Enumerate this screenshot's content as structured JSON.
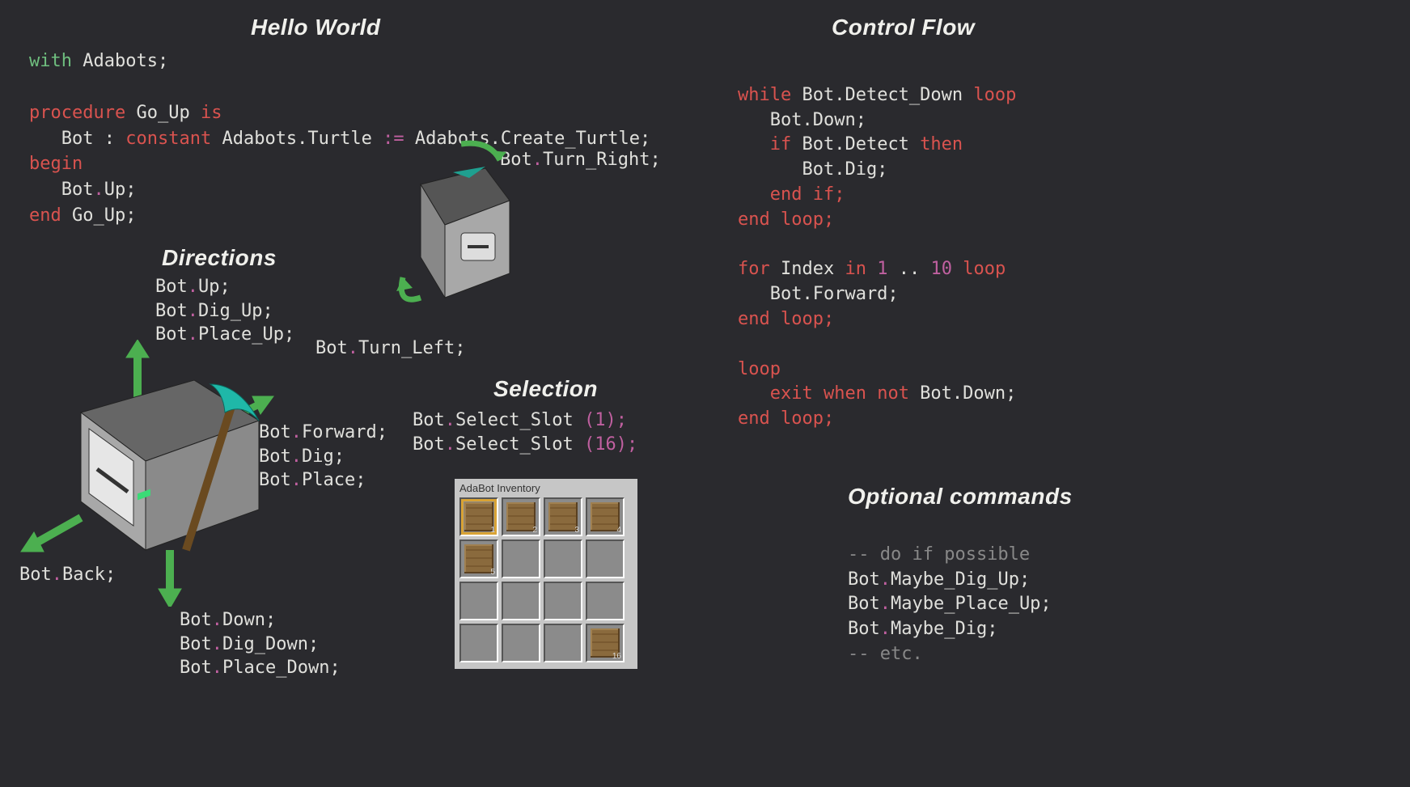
{
  "hello": {
    "title": "Hello World",
    "l1_with": "with",
    "l1_id": "Adabots;",
    "l2_proc": "procedure",
    "l2_name": "Go_Up",
    "l2_is": "is",
    "l3_bot": "Bot",
    "l3_colon": " : ",
    "l3_const": "constant",
    "l3_type": " Adabots.Turtle ",
    "l3_assign": ":=",
    "l3_call": " Adabots.Create_Turtle;",
    "l4_begin": "begin",
    "l5_botup": "   Bot",
    "l5_dot": ".",
    "l5_up": "Up;",
    "l6_end": "end",
    "l6_name": " Go_Up;"
  },
  "directions": {
    "title": "Directions",
    "up1_a": "Bot",
    "up1_b": ".",
    "up1_c": "Up;",
    "up2_a": "Bot",
    "up2_b": ".",
    "up2_c": "Dig_Up;",
    "up3_a": "Bot",
    "up3_b": ".",
    "up3_c": "Place_Up;",
    "fw1_a": "Bot",
    "fw1_b": ".",
    "fw1_c": "Forward;",
    "fw2_a": "Bot",
    "fw2_b": ".",
    "fw2_c": "Dig;",
    "fw3_a": "Bot",
    "fw3_b": ".",
    "fw3_c": "Place;",
    "back_a": "Bot",
    "back_b": ".",
    "back_c": "Back;",
    "dn1_a": "Bot",
    "dn1_b": ".",
    "dn1_c": "Down;",
    "dn2_a": "Bot",
    "dn2_b": ".",
    "dn2_c": "Dig_Down;",
    "dn3_a": "Bot",
    "dn3_b": ".",
    "dn3_c": "Place_Down;",
    "tr_a": "Bot",
    "tr_b": ".",
    "tr_c": "Turn_Right;",
    "tl_a": "Bot",
    "tl_b": ".",
    "tl_c": "Turn_Left;"
  },
  "selection": {
    "title": "Selection",
    "s1_a": "Bot",
    "s1_b": ".",
    "s1_c": "Select_Slot ",
    "s1_p1": "(",
    "s1_n": "1",
    "s1_p2": ");",
    "s2_a": "Bot",
    "s2_b": ".",
    "s2_c": "Select_Slot ",
    "s2_p1": "(",
    "s2_n": "16",
    "s2_p2": ");",
    "inv_title": "AdaBot Inventory",
    "slots": {
      "n1": "1",
      "n2": "2",
      "n3": "3",
      "n4": "4",
      "n5": "5",
      "n16": "16"
    }
  },
  "flow": {
    "title": "Control Flow",
    "w1_while": "while",
    "w1_mid": " Bot.Detect_Down ",
    "w1_loop": "loop",
    "w2": "   Bot.Down;",
    "w3_if": "   if",
    "w3_mid": " Bot.Detect ",
    "w3_then": "then",
    "w4": "      Bot.Dig;",
    "w5": "   end if;",
    "w6": "end loop;",
    "f1_for": "for",
    "f1_idx": " Index ",
    "f1_in": "in",
    "f1_r1": " 1",
    "f1_dots": " .. ",
    "f1_r2": "10 ",
    "f1_loop": "loop",
    "f2": "   Bot.Forward;",
    "f3": "end loop;",
    "l1": "loop",
    "l2_exit": "   exit when",
    "l2_not": " not",
    "l2_rest": " Bot.Down;",
    "l3": "end loop;"
  },
  "optional": {
    "title": "Optional commands",
    "c1": "-- do if possible",
    "o1_a": "Bot",
    "o1_b": ".",
    "o1_c": "Maybe_Dig_Up;",
    "o2_a": "Bot",
    "o2_b": ".",
    "o2_c": "Maybe_Place_Up;",
    "o3_a": "Bot",
    "o3_b": ".",
    "o3_c": "Maybe_Dig;",
    "c2": "-- etc."
  }
}
